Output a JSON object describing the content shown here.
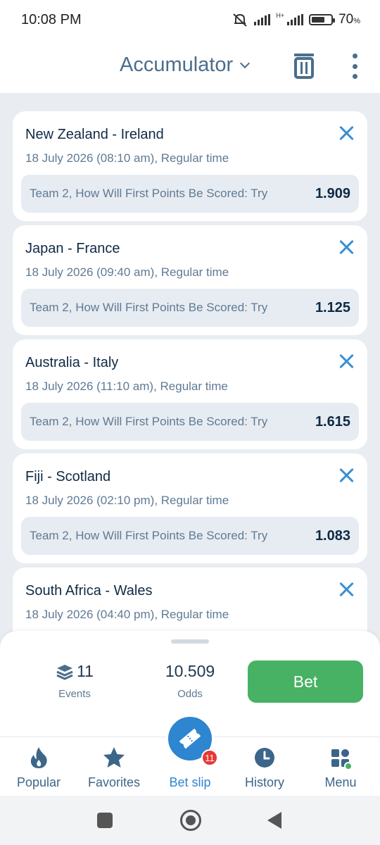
{
  "status_bar": {
    "time": "10:08 PM",
    "network": "H+",
    "battery_percent": "70",
    "battery_unit": "%"
  },
  "header": {
    "title": "Accumulator"
  },
  "bets": [
    {
      "match": "New Zealand - Ireland",
      "datetime": "18 July 2026 (08:10 am), Regular time",
      "selection": "Team 2, How Will First Points Be Scored: Try",
      "odds": "1.909"
    },
    {
      "match": "Japan - France",
      "datetime": "18 July 2026 (09:40 am), Regular time",
      "selection": "Team 2, How Will First Points Be Scored: Try",
      "odds": "1.125"
    },
    {
      "match": "Australia - Italy",
      "datetime": "18 July 2026 (11:10 am), Regular time",
      "selection": "Team 2, How Will First Points Be Scored: Try",
      "odds": "1.615"
    },
    {
      "match": "Fiji - Scotland",
      "datetime": "18 July 2026 (02:10 pm), Regular time",
      "selection": "Team 2, How Will First Points Be Scored: Try",
      "odds": "1.083"
    },
    {
      "match": "South Africa - Wales",
      "datetime": "18 July 2026 (04:40 pm), Regular time",
      "selection": "",
      "odds": ""
    }
  ],
  "summary": {
    "events_count": "11",
    "events_label": "Events",
    "odds_value": "10.509",
    "odds_label": "Odds",
    "bet_label": "Bet"
  },
  "bottom_nav": {
    "popular": "Popular",
    "favorites": "Favorites",
    "bet_slip": "Bet slip",
    "bet_slip_badge": "11",
    "history": "History",
    "menu": "Menu"
  },
  "colors": {
    "accent": "#2d86cf",
    "bet_button": "#47b263",
    "badge": "#e53935",
    "background": "#e9edf2"
  }
}
